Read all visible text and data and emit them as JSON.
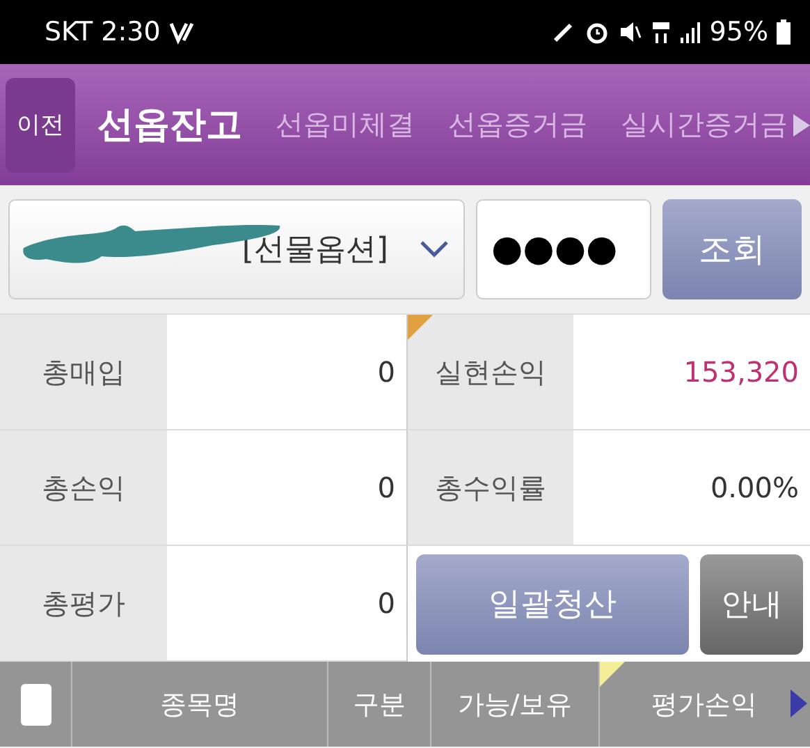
{
  "status_bar": {
    "carrier": "SKT",
    "time": "2:30",
    "battery": "95%"
  },
  "nav": {
    "back": "이전",
    "tabs": [
      {
        "label": "선옵잔고",
        "selected": true
      },
      {
        "label": "선옵미체결",
        "selected": false
      },
      {
        "label": "선옵증거금",
        "selected": false
      },
      {
        "label": "실시간증거금",
        "selected": false
      }
    ]
  },
  "form": {
    "account": "[선물옵션]",
    "password": "●●●●",
    "query_button": "조회"
  },
  "summary": [
    {
      "kind": "profit",
      "label": "총매입",
      "value": "0",
      "label2": "실현손익",
      "value2": "153,320"
    },
    {
      "kind": "plain",
      "label": "총손익",
      "value": "0",
      "label2": "총수익률",
      "value2": "0.00%"
    },
    {
      "kind": "buttons",
      "label": "총평가",
      "value": "0"
    }
  ],
  "buttons": [
    "일괄청산",
    "안내"
  ],
  "table": {
    "select_all": {
      "checked": false
    },
    "columns": [
      "종목명",
      "구분",
      "가능/보유",
      "평가손익"
    ]
  }
}
